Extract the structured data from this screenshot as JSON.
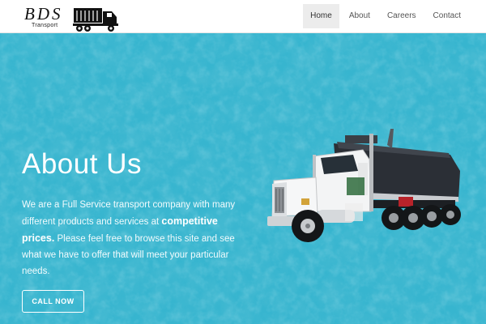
{
  "brand": {
    "logo_text": "BDS",
    "logo_subtext": "Transport",
    "logo_icon": "dump-truck-icon"
  },
  "nav": {
    "items": [
      {
        "label": "Home",
        "active": true
      },
      {
        "label": "About",
        "active": false
      },
      {
        "label": "Careers",
        "active": false
      },
      {
        "label": "Contact",
        "active": false
      }
    ]
  },
  "hero": {
    "title": "About Us",
    "text_before": "We are a Full Service transport company with many different products and services at",
    "text_bold": "competitive prices.",
    "text_after": "Please feel free to browse this site and see what we have to offer that will meet your particular needs.",
    "cta_label": "CALL NOW",
    "image": "dump-truck-photo",
    "background_color": "#36b4ce"
  },
  "colors": {
    "accent": "#36b4ce",
    "nav_active_bg": "#ececec"
  }
}
